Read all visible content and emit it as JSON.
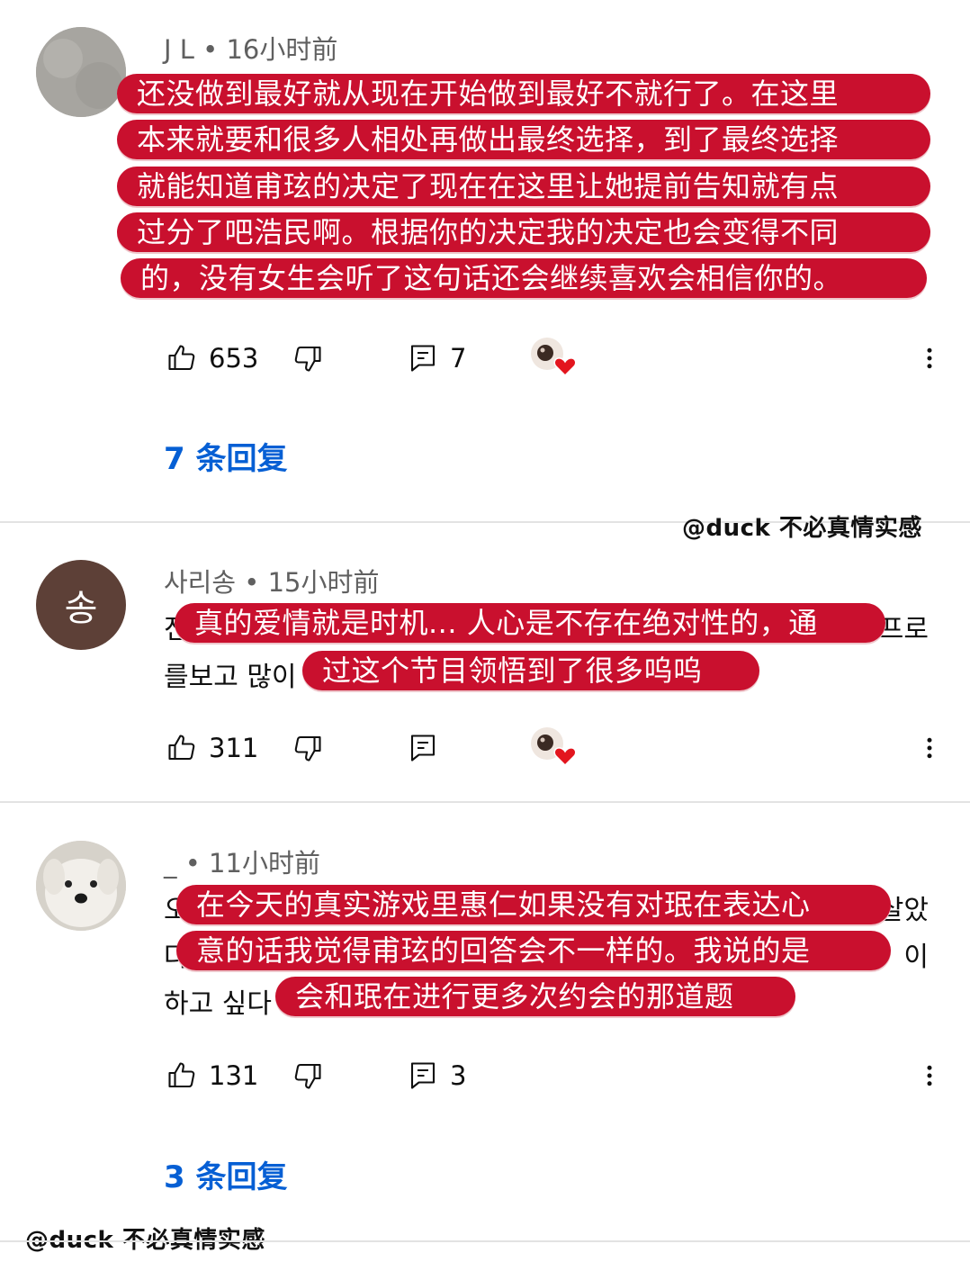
{
  "comments": [
    {
      "author": "J L",
      "time": "16小时前",
      "avatar_icon": "gray-blur-avatar",
      "highlight_lines": [
        "还没做到最好就从现在开始做到最好不就行了。在这里",
        "本来就要和很多人相处再做出最终选择，到了最终选择",
        "就能知道甫玹的决定了现在在这里让她提前告知就有点",
        "过分了吧浩民啊。根据你的决定我的决定也会变得不同",
        "的，没有女生会听了这句话还会继续喜欢会相信你的。"
      ],
      "likes": "653",
      "reply_count": "7",
      "replies_link": "7 条回复",
      "creator_heart": true
    },
    {
      "author": "사리송",
      "time": "15小时前",
      "avatar_letter": "송",
      "avatar_color": "#5d4037",
      "original_fragments": [
        "전",
        "프로",
        "를보고 많이"
      ],
      "highlight_lines": [
        "真的爱情就是时机... 人心是不存在绝对性的，通",
        "过这个节目领悟到了很多呜呜"
      ],
      "likes": "311",
      "creator_heart": true
    },
    {
      "author": "_",
      "time": "11小时前",
      "avatar_icon": "white-dog-avatar",
      "original_fragments": [
        "오",
        "살았",
        "다",
        "이",
        "하고 싶다"
      ],
      "highlight_lines": [
        "在今天的真实游戏里惠仁如果没有对珉在表达心",
        "意的话我觉得甫玹的回答会不一样的。我说的是",
        "会和珉在进行更多次约会的那道题"
      ],
      "likes": "131",
      "reply_count": "3",
      "replies_link": "3 条回复"
    }
  ],
  "watermarks": [
    "@duck 不必真情实感",
    "@duck 不必真情实感"
  ],
  "colors": {
    "highlight": "#c9102e",
    "link": "#065fd4",
    "meta_text": "#606060"
  }
}
